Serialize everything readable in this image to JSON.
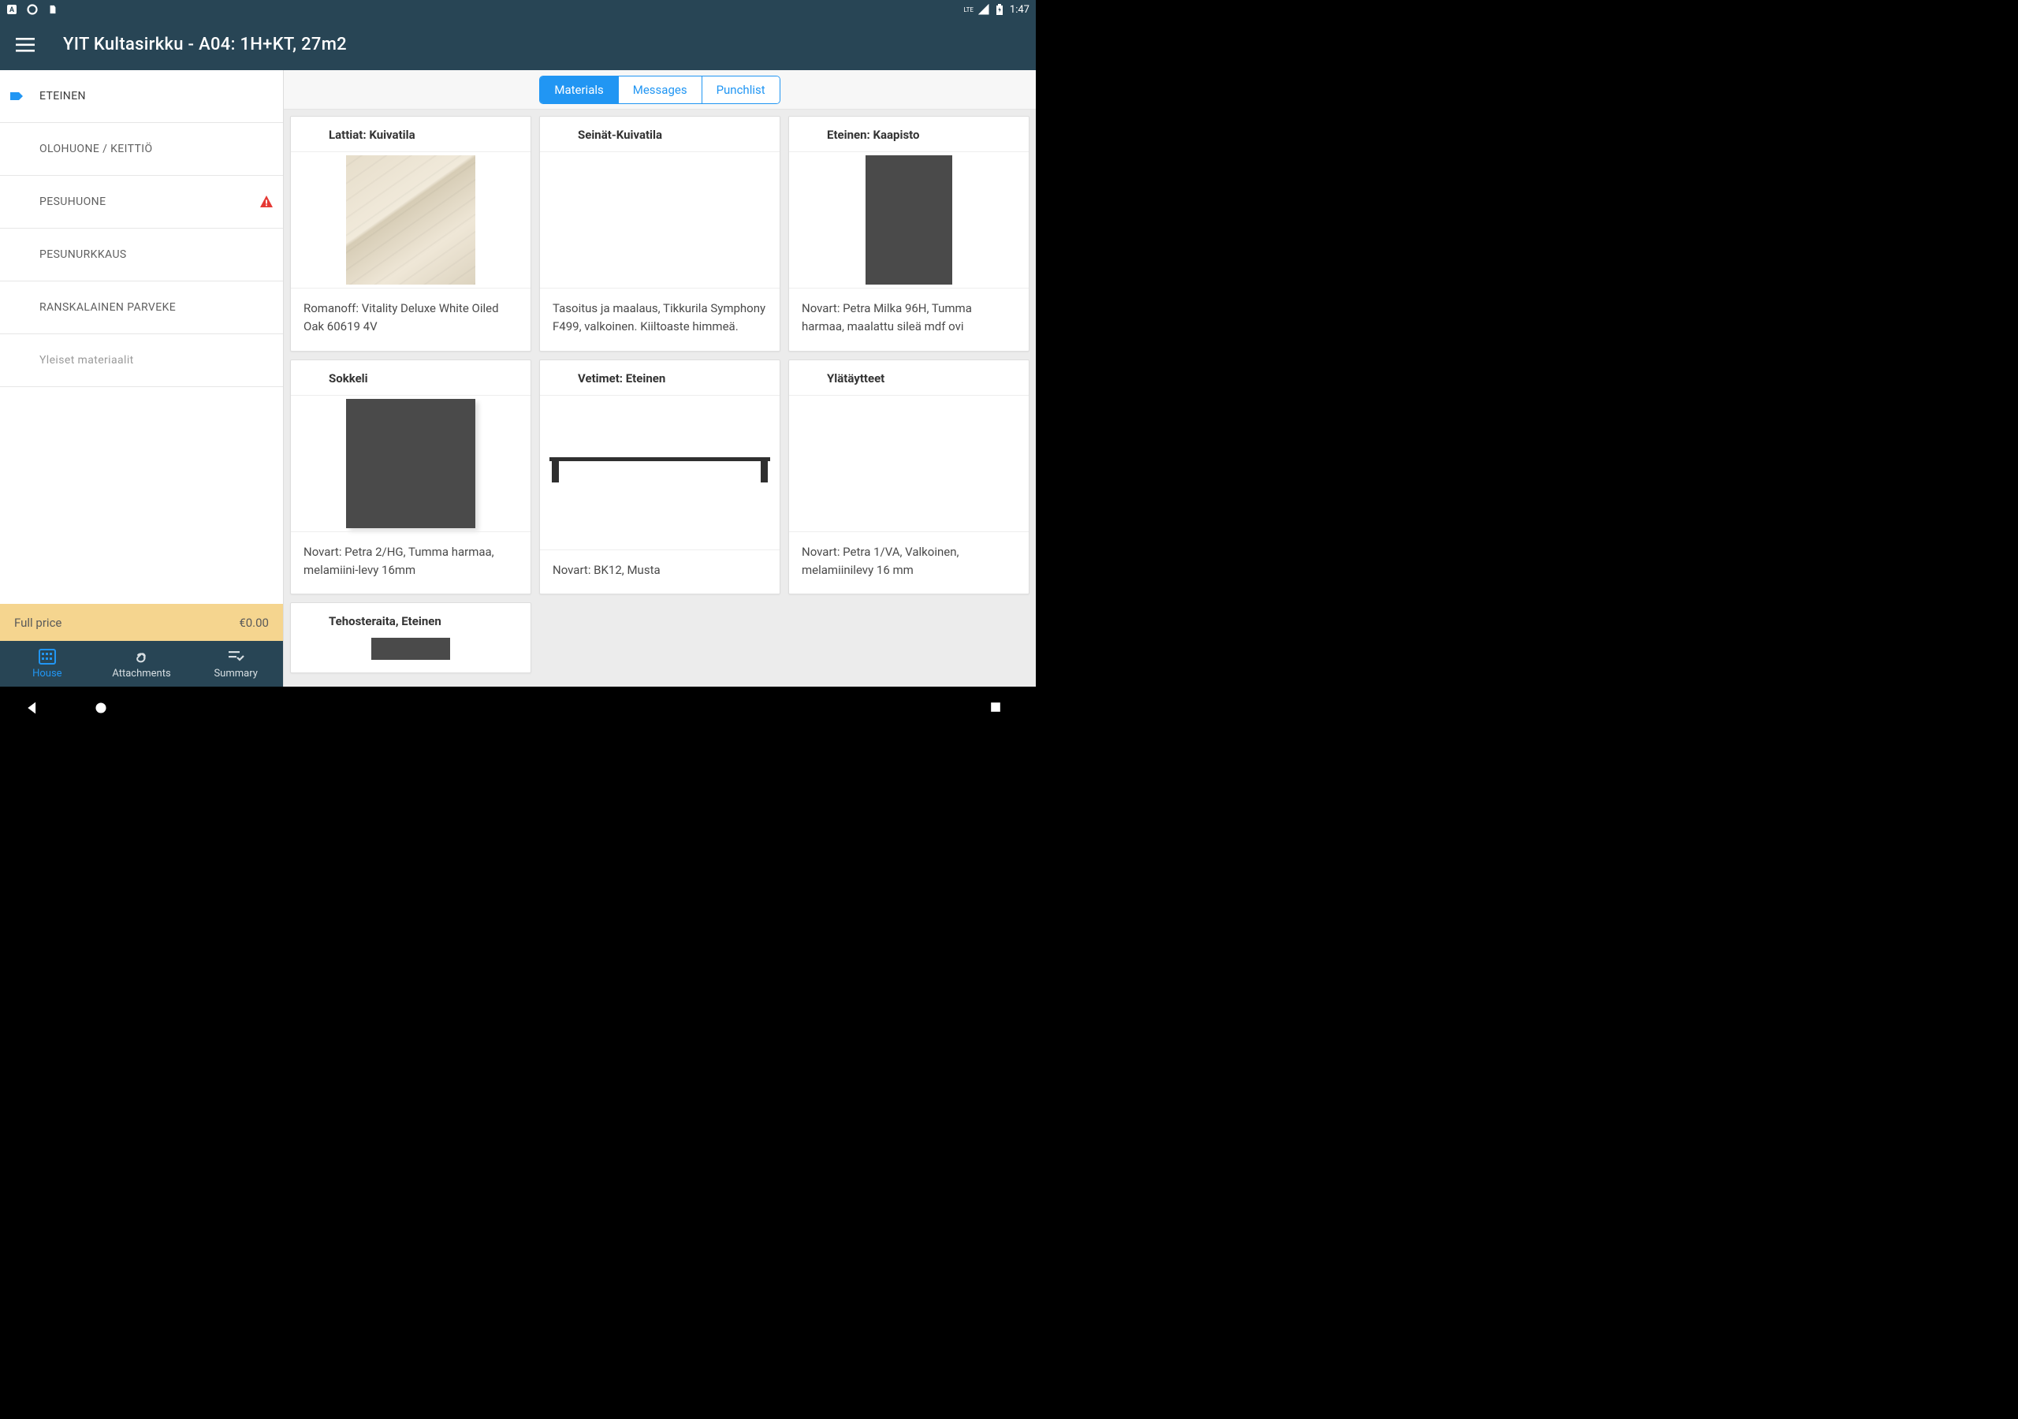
{
  "statusbar": {
    "network": "LTE",
    "time": "1:47"
  },
  "header": {
    "title": "YIT Kultasirkku - A04: 1H+KT, 27m2"
  },
  "sidebar": {
    "rooms": [
      {
        "label": "ETEINEN",
        "active": true,
        "alert": false
      },
      {
        "label": "OLOHUONE / KEITTIÖ",
        "active": false,
        "alert": false
      },
      {
        "label": "PESUHUONE",
        "active": false,
        "alert": true
      },
      {
        "label": "PESUNURKKAUS",
        "active": false,
        "alert": false
      },
      {
        "label": "RANSKALAINEN PARVEKE",
        "active": false,
        "alert": false
      }
    ],
    "general": "Yleiset materiaalit"
  },
  "price": {
    "label": "Full price",
    "value": "€0.00"
  },
  "bottom_tabs": {
    "house": "House",
    "attachments": "Attachments",
    "summary": "Summary"
  },
  "top_tabs": {
    "materials": "Materials",
    "messages": "Messages",
    "punchlist": "Punchlist"
  },
  "cards": [
    {
      "title": "Lattiat: Kuivatila",
      "desc": "Romanoff: Vitality Deluxe White Oiled Oak 60619 4V",
      "swatch": "wood"
    },
    {
      "title": "Seinät-Kuivatila",
      "desc": "Tasoitus ja maalaus, Tikkurila Symphony F499, valkoinen. Kiiltoaste himmeä.",
      "swatch": "blank"
    },
    {
      "title": "Eteinen: Kaapisto",
      "desc": "Novart: Petra Milka 96H, Tumma harmaa, maalattu sileä mdf ovi",
      "swatch": "darkgray"
    },
    {
      "title": "Sokkeli",
      "desc": "Novart: Petra 2/HG, Tumma harmaa, melamiini-levy 16mm",
      "swatch": "darkgray2"
    },
    {
      "title": "Vetimet: Eteinen",
      "desc": "Novart: BK12, Musta",
      "swatch": "handle"
    },
    {
      "title": "Ylätäytteet",
      "desc": "Novart: Petra 1/VA, Valkoinen, melamiinilevy 16 mm",
      "swatch": "blank"
    },
    {
      "title": "Tehosteraita, Eteinen",
      "desc": "",
      "swatch": "tehoste"
    }
  ]
}
